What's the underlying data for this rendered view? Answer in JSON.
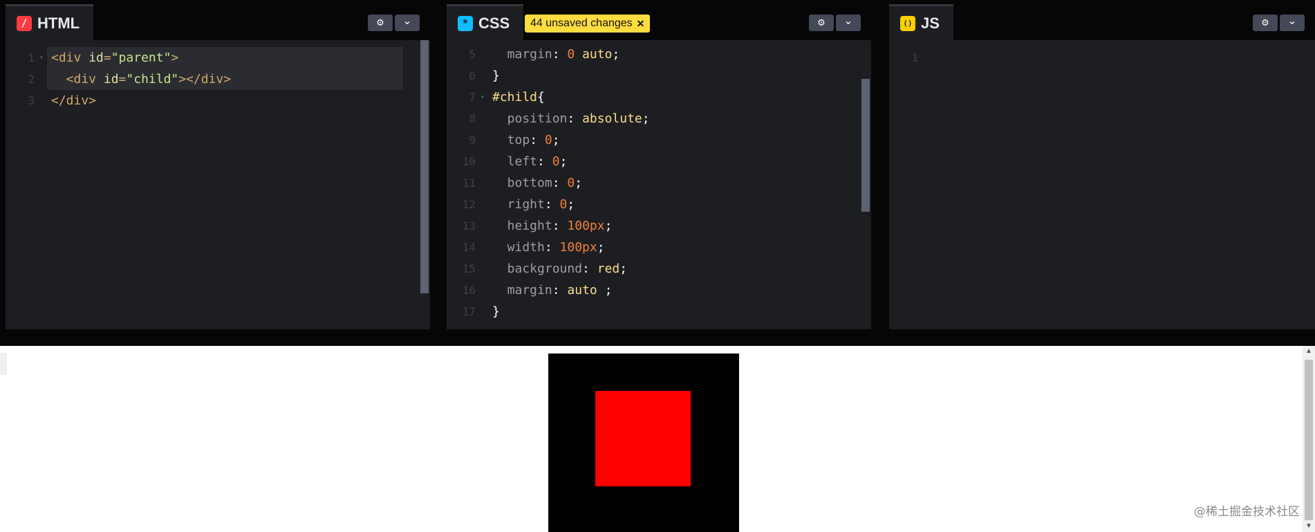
{
  "panels": {
    "html": {
      "tab_label": "HTML",
      "icon": "slash-icon",
      "icon_char": "/",
      "icon_color": "#ff3c41",
      "lines": [
        {
          "n": "1",
          "fold": true,
          "tokens": [
            [
              "t-tag",
              "<div "
            ],
            [
              "t-attr",
              "id"
            ],
            [
              "t-punc",
              "="
            ],
            [
              "t-str",
              "\"parent\""
            ],
            [
              "t-tag",
              ">"
            ]
          ]
        },
        {
          "n": "2",
          "fold": false,
          "tokens": [
            [
              "t-tag",
              "  <div "
            ],
            [
              "t-attr",
              "id"
            ],
            [
              "t-punc",
              "="
            ],
            [
              "t-str",
              "\"child\""
            ],
            [
              "t-tag",
              "></div>"
            ]
          ]
        },
        {
          "n": "3",
          "fold": false,
          "tokens": [
            [
              "t-tag",
              "</div>"
            ]
          ]
        }
      ]
    },
    "css": {
      "tab_label": "CSS",
      "icon": "asterisk-icon",
      "icon_char": "*",
      "icon_color": "#0ebeff",
      "badge_text": "44 unsaved changes",
      "badge_close": "✕",
      "lines": [
        {
          "n": "5",
          "fold": false,
          "tokens": [
            [
              "t-prop",
              "  margin"
            ],
            [
              "t-plain",
              ": "
            ],
            [
              "t-num",
              "0"
            ],
            [
              "t-plain",
              " "
            ],
            [
              "t-kw",
              "auto"
            ],
            [
              "t-plain",
              ";"
            ]
          ]
        },
        {
          "n": "6",
          "fold": false,
          "tokens": [
            [
              "t-plain",
              "}"
            ]
          ]
        },
        {
          "n": "7",
          "fold": true,
          "tokens": [
            [
              "t-kw",
              "#child"
            ],
            [
              "t-plain",
              "{"
            ]
          ]
        },
        {
          "n": "8",
          "fold": false,
          "tokens": [
            [
              "t-prop",
              "  position"
            ],
            [
              "t-plain",
              ": "
            ],
            [
              "t-kw",
              "absolute"
            ],
            [
              "t-plain",
              ";"
            ]
          ]
        },
        {
          "n": "9",
          "fold": false,
          "tokens": [
            [
              "t-prop",
              "  top"
            ],
            [
              "t-plain",
              ": "
            ],
            [
              "t-num",
              "0"
            ],
            [
              "t-plain",
              ";"
            ]
          ]
        },
        {
          "n": "10",
          "fold": false,
          "tokens": [
            [
              "t-prop",
              "  left"
            ],
            [
              "t-plain",
              ": "
            ],
            [
              "t-num",
              "0"
            ],
            [
              "t-plain",
              ";"
            ]
          ]
        },
        {
          "n": "11",
          "fold": false,
          "tokens": [
            [
              "t-prop",
              "  bottom"
            ],
            [
              "t-plain",
              ": "
            ],
            [
              "t-num",
              "0"
            ],
            [
              "t-plain",
              ";"
            ]
          ]
        },
        {
          "n": "12",
          "fold": false,
          "tokens": [
            [
              "t-prop",
              "  right"
            ],
            [
              "t-plain",
              ": "
            ],
            [
              "t-num",
              "0"
            ],
            [
              "t-plain",
              ";"
            ]
          ]
        },
        {
          "n": "13",
          "fold": false,
          "tokens": [
            [
              "t-prop",
              "  height"
            ],
            [
              "t-plain",
              ": "
            ],
            [
              "t-num",
              "100px"
            ],
            [
              "t-plain",
              ";"
            ]
          ]
        },
        {
          "n": "14",
          "fold": false,
          "tokens": [
            [
              "t-prop",
              "  width"
            ],
            [
              "t-plain",
              ": "
            ],
            [
              "t-num",
              "100px"
            ],
            [
              "t-plain",
              ";"
            ]
          ]
        },
        {
          "n": "15",
          "fold": false,
          "tokens": [
            [
              "t-prop",
              "  background"
            ],
            [
              "t-plain",
              ": "
            ],
            [
              "t-kw",
              "red"
            ],
            [
              "t-plain",
              ";"
            ]
          ]
        },
        {
          "n": "16",
          "fold": false,
          "tokens": [
            [
              "t-prop",
              "  margin"
            ],
            [
              "t-plain",
              ": "
            ],
            [
              "t-kw",
              "auto"
            ],
            [
              "t-plain",
              " ;"
            ]
          ]
        },
        {
          "n": "17",
          "fold": false,
          "tokens": [
            [
              "t-plain",
              "}"
            ]
          ]
        }
      ]
    },
    "js": {
      "tab_label": "JS",
      "icon": "braces-icon",
      "icon_char": "()",
      "icon_color": "#fcd000",
      "lines": [
        {
          "n": "1",
          "fold": false,
          "tokens": []
        }
      ]
    }
  },
  "header_buttons": {
    "settings_icon": "gear-icon",
    "settings_glyph": "⚙",
    "collapse_icon": "chevron-down-icon",
    "collapse_glyph": "⌄"
  },
  "preview": {
    "parent_color": "#000000",
    "child_color": "#ff0000"
  },
  "watermark": "@稀土掘金技术社区"
}
